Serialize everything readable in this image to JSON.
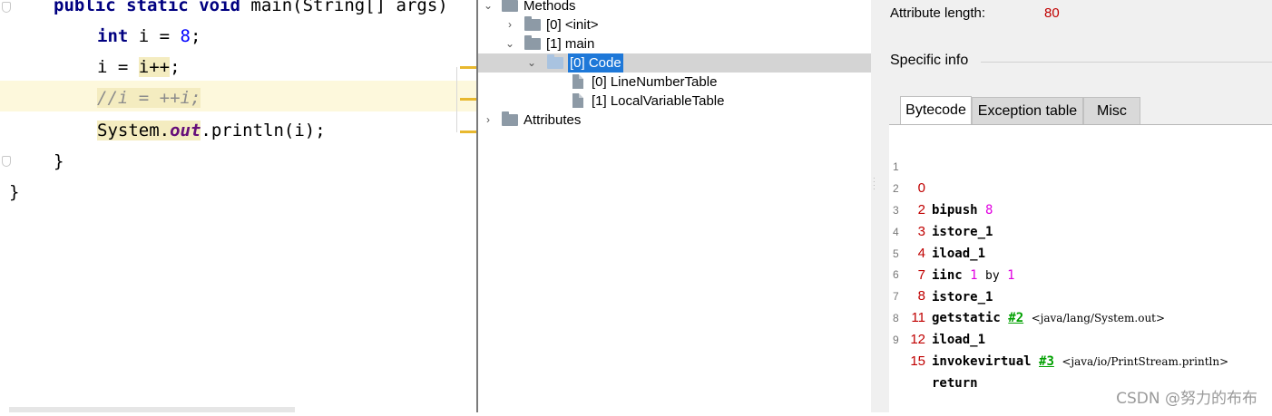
{
  "editor": {
    "line_signature": {
      "kw1": "public",
      "kw2": "static",
      "kw3": "void",
      "rest": " main(String[] args)"
    },
    "line_decl": {
      "kw": "int",
      "rest": " i = ",
      "num": "8",
      "end": ";"
    },
    "line_assign": {
      "lhs": "i = ",
      "hl": "i++",
      "end": ";"
    },
    "line_comment": {
      "text": "//i = ++i;"
    },
    "line_print": {
      "cls": "System.",
      "field": "out",
      "rest": ".println(i);"
    },
    "line_close_inner": "}",
    "line_close_outer": "}"
  },
  "tree": {
    "methods_label": "Methods",
    "init_label": "[0] <init>",
    "main_label": "[1] main",
    "code_label": "[0] Code",
    "line_number_table_label": "[0] LineNumberTable",
    "local_variable_table_label": "[1] LocalVariableTable",
    "attributes_label": "Attributes"
  },
  "info": {
    "attribute_length_label": "Attribute length:",
    "attribute_length_value": "80",
    "specific_info_label": "Specific info",
    "tabs": [
      "Bytecode",
      "Exception table",
      "Misc"
    ],
    "active_tab": "Bytecode"
  },
  "bytecode": [
    {
      "line": "1",
      "offset": "0",
      "instr": "bipush",
      "arg": "8"
    },
    {
      "line": "2",
      "offset": "2",
      "instr": "istore_1"
    },
    {
      "line": "3",
      "offset": "3",
      "instr": "iload_1"
    },
    {
      "line": "4",
      "offset": "4",
      "instr": "iinc",
      "arg": "1",
      "by": "by",
      "arg2": "1"
    },
    {
      "line": "5",
      "offset": "7",
      "instr": "istore_1"
    },
    {
      "line": "6",
      "offset": "8",
      "instr": "getstatic",
      "ref": "#2",
      "comment": "<java/lang/System.out>"
    },
    {
      "line": "7",
      "offset": "11",
      "instr": "iload_1"
    },
    {
      "line": "8",
      "offset": "12",
      "instr": "invokevirtual",
      "ref": "#3",
      "comment": "<java/io/PrintStream.println>"
    },
    {
      "line": "9",
      "offset": "15",
      "instr": "return"
    }
  ],
  "watermark": "CSDN @努力的布布",
  "colors": {
    "selection": "#1e78d8",
    "offset_red": "#c00000",
    "constant_magenta": "#e000e0",
    "ref_green": "#00a000",
    "keyword_navy": "#000080"
  },
  "icons": [
    "chevron-right-icon",
    "chevron-down-icon",
    "folder-icon",
    "file-icon"
  ]
}
